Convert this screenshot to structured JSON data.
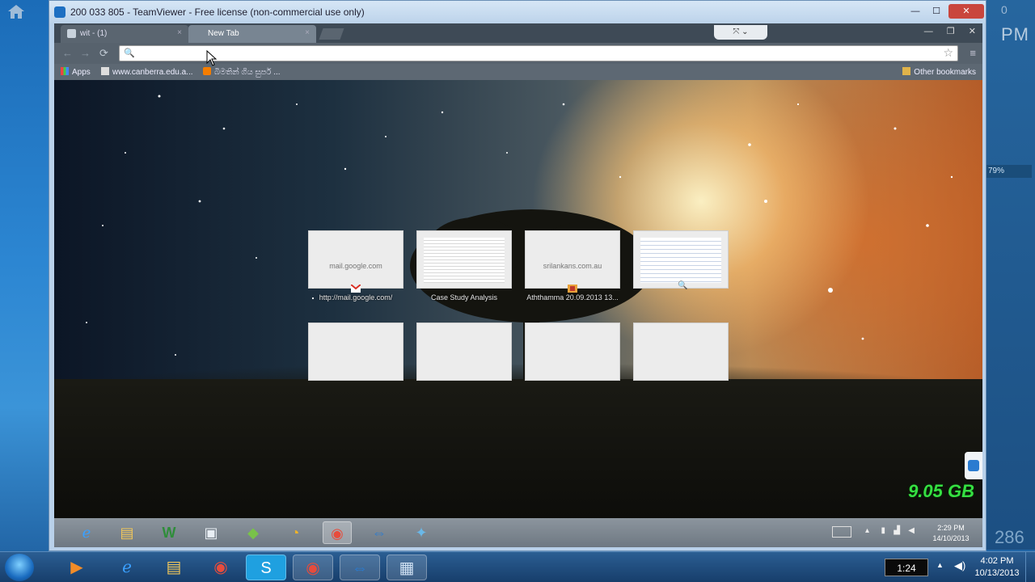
{
  "desktop": {
    "right_fragments": {
      "zero": "0",
      "pm": "PM",
      "percent": "79%",
      "number": "286"
    }
  },
  "teamviewer": {
    "title": "200 033 805 - TeamViewer - Free license (non-commercial use only)",
    "controls": {
      "minimize": "—",
      "maximize": "☐",
      "close": "✕"
    }
  },
  "chrome": {
    "tabs": [
      {
        "label": "wit - (1)",
        "close": "×"
      },
      {
        "label": "New Tab",
        "close": "×"
      }
    ],
    "window_controls": {
      "minimize": "—",
      "restore": "❐",
      "close": "✕"
    },
    "tv_panel": "⤧ ⌄",
    "omnibox": {
      "value": "",
      "placeholder": ""
    },
    "nav": {
      "back": "←",
      "forward": "→",
      "reload": "⟳"
    },
    "bookmarks": [
      {
        "label": "Apps"
      },
      {
        "label": "www.canberra.edu.a..."
      },
      {
        "label": "බිමතින් ගිය සුපර් ..."
      }
    ],
    "other_bookmarks": "Other bookmarks"
  },
  "new_tab_page": {
    "tiles": [
      {
        "site": "mail.google.com",
        "label": "http://mail.google.com/"
      },
      {
        "site": "",
        "label": "Case Study Analysis"
      },
      {
        "site": "srilankans.com.au",
        "label": "Aththamma 20.09.2013 13..."
      },
      {
        "site": "",
        "label": ""
      },
      {
        "site": "",
        "label": ""
      },
      {
        "site": "",
        "label": ""
      },
      {
        "site": "",
        "label": ""
      },
      {
        "site": "",
        "label": ""
      }
    ]
  },
  "overlay": {
    "disk_free": "9.05 GB"
  },
  "remote_taskbar": {
    "apps": [
      "ie-icon",
      "explorer-icon",
      "word-icon",
      "media-icon",
      "evernote-icon",
      "gauge-icon",
      "chrome-icon",
      "teamviewer-icon",
      "network-icon"
    ],
    "clock": {
      "time": "2:29 PM",
      "date": "14/10/2013"
    }
  },
  "local_taskbar": {
    "apps": [
      "media-player-icon",
      "ie-icon",
      "explorer-icon",
      "chrome-icon",
      "skype-icon",
      "chrome-icon",
      "teamviewer-icon",
      "film-icon"
    ],
    "timer": "1:24",
    "clock": {
      "time": "4:02 PM",
      "date": "10/13/2013"
    }
  },
  "colors": {
    "accent_green": "#35e042",
    "teamviewer_blue": "#2a7bd0",
    "close_red": "#c9463d"
  }
}
